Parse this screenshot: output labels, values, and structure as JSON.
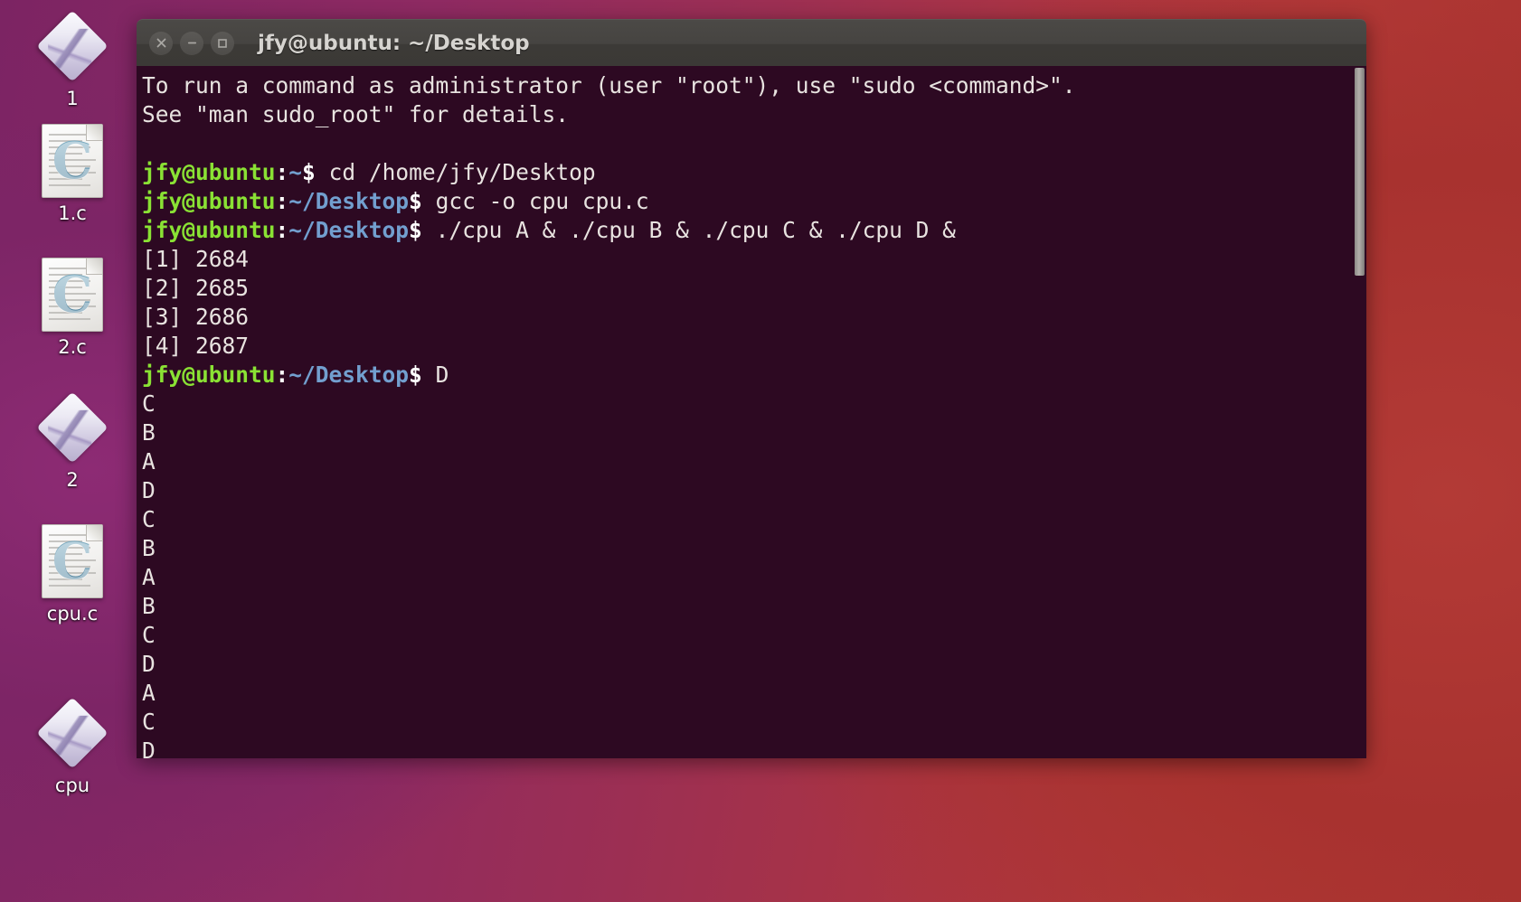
{
  "desktop": {
    "icons": [
      {
        "label": "1",
        "type": "executable"
      },
      {
        "label": "1.c",
        "type": "c-source",
        "glyph": "C"
      },
      {
        "label": "2.c",
        "type": "c-source",
        "glyph": "C"
      },
      {
        "label": "2",
        "type": "executable"
      },
      {
        "label": "cpu.c",
        "type": "c-source",
        "glyph": "C"
      },
      {
        "label": "cpu",
        "type": "executable"
      }
    ]
  },
  "window": {
    "title": "jfy@ubuntu: ~/Desktop",
    "controls": [
      {
        "name": "close",
        "glyph": "×"
      },
      {
        "name": "minimize",
        "glyph": "−"
      },
      {
        "name": "maximize",
        "glyph": "□"
      }
    ]
  },
  "terminal": {
    "prompt_user": "jfy@ubuntu",
    "lines": [
      {
        "type": "plain",
        "text": "To run a command as administrator (user \"root\"), use \"sudo <command>\"."
      },
      {
        "type": "plain",
        "text": "See \"man sudo_root\" for details."
      },
      {
        "type": "plain",
        "text": ""
      },
      {
        "type": "prompt",
        "user": "jfy@ubuntu",
        "sep": ":",
        "path": "~",
        "tail": "$",
        "command": " cd /home/jfy/Desktop"
      },
      {
        "type": "prompt",
        "user": "jfy@ubuntu",
        "sep": ":",
        "path": "~/Desktop",
        "tail": "$",
        "command": " gcc -o cpu cpu.c"
      },
      {
        "type": "prompt",
        "user": "jfy@ubuntu",
        "sep": ":",
        "path": "~/Desktop",
        "tail": "$",
        "command": " ./cpu A & ./cpu B & ./cpu C & ./cpu D &"
      },
      {
        "type": "plain",
        "text": "[1] 2684"
      },
      {
        "type": "plain",
        "text": "[2] 2685"
      },
      {
        "type": "plain",
        "text": "[3] 2686"
      },
      {
        "type": "plain",
        "text": "[4] 2687"
      },
      {
        "type": "prompt",
        "user": "jfy@ubuntu",
        "sep": ":",
        "path": "~/Desktop",
        "tail": "$",
        "command": " D"
      },
      {
        "type": "plain",
        "text": "C"
      },
      {
        "type": "plain",
        "text": "B"
      },
      {
        "type": "plain",
        "text": "A"
      },
      {
        "type": "plain",
        "text": "D"
      },
      {
        "type": "plain",
        "text": "C"
      },
      {
        "type": "plain",
        "text": "B"
      },
      {
        "type": "plain",
        "text": "A"
      },
      {
        "type": "plain",
        "text": "B"
      },
      {
        "type": "plain",
        "text": "C"
      },
      {
        "type": "plain",
        "text": "D"
      },
      {
        "type": "plain",
        "text": "A"
      },
      {
        "type": "plain",
        "text": "C"
      },
      {
        "type": "plain",
        "text": "D"
      }
    ]
  },
  "colors": {
    "terminal_background": "#2d0922",
    "prompt_user": "#8ae234",
    "prompt_path": "#729fcf",
    "text": "#e8e3e0",
    "titlebar": "#46443f",
    "desktop_left": "#7c2463",
    "desktop_right": "#b33a36"
  }
}
